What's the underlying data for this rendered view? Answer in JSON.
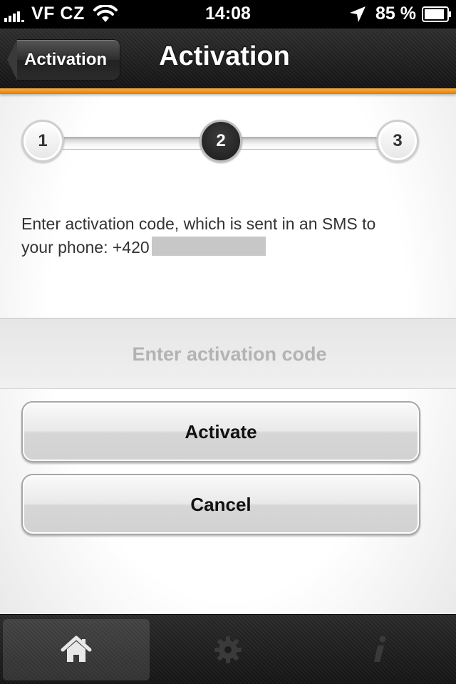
{
  "status_bar": {
    "carrier": "VF CZ",
    "time": "14:08",
    "battery": "85 %"
  },
  "nav": {
    "back_label": "Activation",
    "title": "Activation"
  },
  "stepper": {
    "steps": [
      "1",
      "2",
      "3"
    ],
    "active_step": 2
  },
  "instruction": {
    "line1": "Enter activation code, which is sent in an SMS to",
    "line2": "your phone: +420"
  },
  "code_field": {
    "placeholder": "Enter activation code",
    "value": ""
  },
  "buttons": {
    "activate": "Activate",
    "cancel": "Cancel"
  },
  "tab_bar": {
    "tabs": [
      {
        "icon": "home-icon",
        "selected": true
      },
      {
        "icon": "gear-icon",
        "selected": false
      },
      {
        "icon": "info-icon",
        "selected": false
      }
    ]
  },
  "colors": {
    "accent_orange": "#f59a1e",
    "bar_dark": "#1c1c1c"
  }
}
